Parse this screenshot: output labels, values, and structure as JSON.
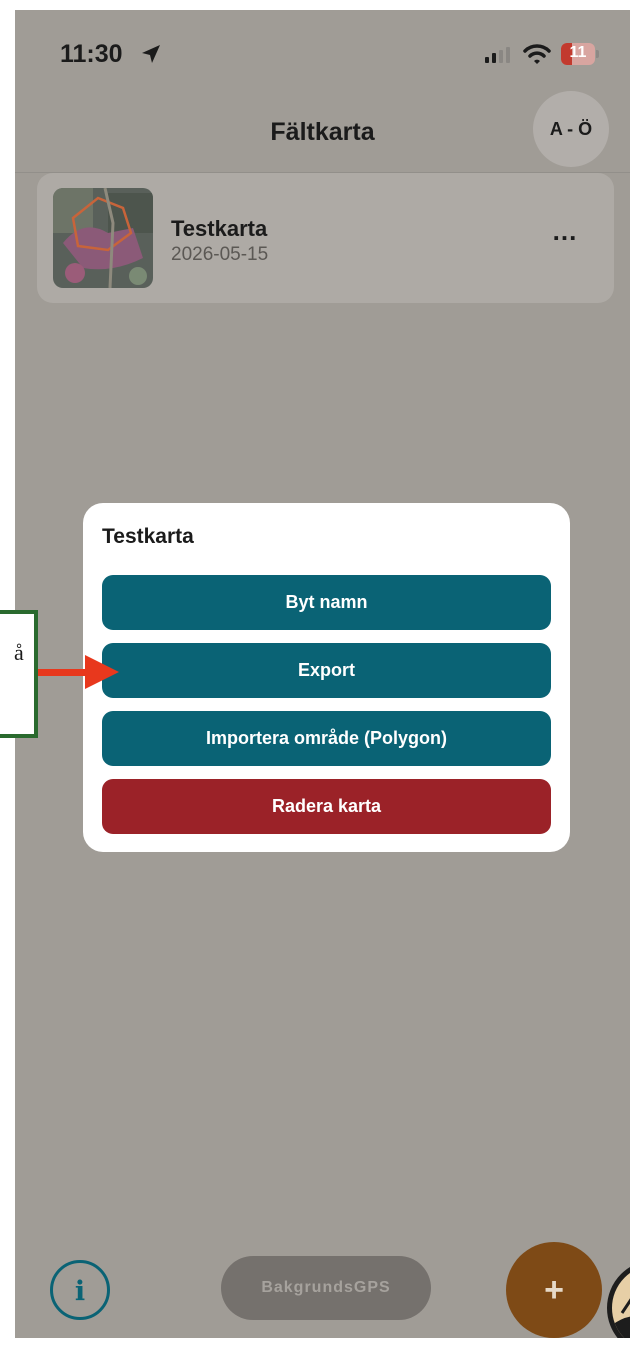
{
  "status_bar": {
    "time": "11:30",
    "battery": "11"
  },
  "header": {
    "title": "Fältkarta",
    "sort_label": "A - Ö"
  },
  "maps": [
    {
      "title": "Testkarta",
      "date": "2026-05-15",
      "more_label": "..."
    }
  ],
  "modal": {
    "title": "Testkarta",
    "buttons": [
      {
        "label": "Byt namn"
      },
      {
        "label": "Export"
      },
      {
        "label": "Importera område (Polygon)"
      },
      {
        "label": "Radera karta"
      }
    ]
  },
  "bottom_bar": {
    "info_label": "i",
    "gps_label": "BakgrundsGPS",
    "add_label": "+"
  },
  "annotation": {
    "callout_text": "å"
  },
  "colors": {
    "overlay": "#a09c96",
    "primary_button": "#0a6375",
    "danger_button": "#9b2228",
    "add_button": "#7e4a16",
    "annotation_arrow": "#e8381d",
    "annotation_border": "#2a6a2e"
  }
}
